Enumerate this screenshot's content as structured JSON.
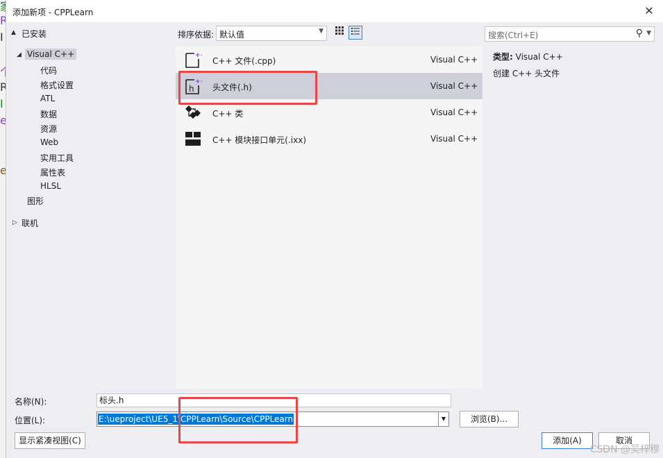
{
  "dialog": {
    "title": "添加新项 - CPPLearn",
    "close_glyph": "✕"
  },
  "edge": [
    "家",
    "R",
    "I",
    "个",
    "R",
    "I",
    "e",
    "e"
  ],
  "tree": {
    "installed": "已安装",
    "visual_cpp": "Visual C++",
    "children": [
      "代码",
      "格式设置",
      "ATL",
      "数据",
      "资源",
      "Web",
      "实用工具",
      "属性表",
      "HLSL"
    ],
    "graphics": "图形",
    "online": "联机"
  },
  "toolbar": {
    "sort_label": "排序依据:",
    "sort_value": "默认值"
  },
  "search": {
    "placeholder": "搜索(Ctrl+E)"
  },
  "templates": [
    {
      "name": "C++ 文件(.cpp)",
      "lang": "Visual C++"
    },
    {
      "name": "头文件(.h)",
      "lang": "Visual C++"
    },
    {
      "name": "C++ 类",
      "lang": "Visual C++"
    },
    {
      "name": "C++ 模块接口单元(.ixx)",
      "lang": "Visual C++"
    }
  ],
  "details": {
    "type_label": "类型:",
    "type_value": "Visual C++",
    "description": "创建 C++ 头文件"
  },
  "form": {
    "name_label": "名称(N):",
    "name_value": "标头.h",
    "location_label": "位置(L):",
    "location_value": "E:\\ueproject\\UE5_1\\CPPLearn\\Source\\CPPLearn",
    "browse": "浏览(B)...",
    "compact_view": "显示紧凑视图(C)",
    "add": "添加(A)",
    "cancel": "取消"
  },
  "watermark": "CSDN @吴梓穆",
  "colors": {
    "selection": "#cfcfd9",
    "highlight": "#e8474a",
    "accent": "#0078d7"
  }
}
